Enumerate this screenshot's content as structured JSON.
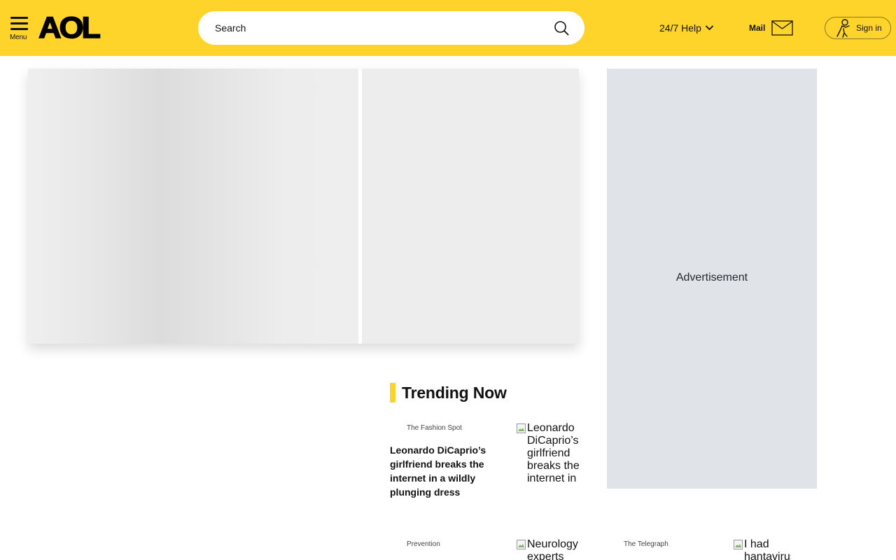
{
  "header": {
    "menu_label": "Menu",
    "logo_text": "AOL",
    "search": {
      "placeholder": "Search",
      "value": ""
    },
    "help_label": "24/7 Help",
    "mail_label": "Mail",
    "signin_label": "Sign in",
    "brand_color": "#ffd42a"
  },
  "ad": {
    "label": "Advertisement"
  },
  "trending": {
    "title": "Trending Now",
    "items": [
      {
        "source": "The Fashion Spot",
        "title": "Leonardo DiCaprio’s girlfriend breaks the internet in a wildly plunging dress",
        "image_alt": "Leonardo DiCaprio’s girlfriend breaks the internet in a"
      },
      {
        "source": "Prevention",
        "image_alt": "Neurology experts"
      },
      {
        "source": "The Telegraph",
        "image_alt": "I had hantavirus"
      }
    ]
  }
}
